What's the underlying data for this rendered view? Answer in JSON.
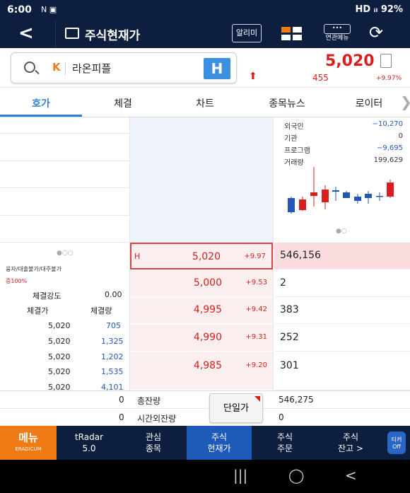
{
  "status": {
    "time": "6:00",
    "left_icons": "N ▣",
    "right": "HD ᵢₗ 92%"
  },
  "header": {
    "back_label": "<",
    "title": "주식현재가",
    "alarm_label": "알리미",
    "menu_label": "연관메뉴",
    "menu_dots": "•••",
    "refresh_label": "⟳"
  },
  "search": {
    "badge": "K",
    "stock_name": "라온피플",
    "h_button": "H"
  },
  "quote": {
    "price": "5,020",
    "change": "455",
    "pct": "+9.97%",
    "arrow": "⬆"
  },
  "tabs": [
    "호가",
    "체결",
    "차트",
    "종목뉴스",
    "로이터"
  ],
  "info": [
    {
      "label": "외국인",
      "value": "−10,270",
      "color": "#2257b5"
    },
    {
      "label": "기관",
      "value": "0",
      "color": "#333333"
    },
    {
      "label": "프로그램",
      "value": "−9,695",
      "color": "#2257b5"
    },
    {
      "label": "거래량",
      "value": "199,629",
      "color": "#333333"
    }
  ],
  "left_info": {
    "dots": "●○○",
    "flags": "융자/대출불가/대주불가",
    "margin": "증100%",
    "strength_label": "체결강도",
    "strength_value": "0.00",
    "col_price": "체결가",
    "col_qty": "체결량"
  },
  "trades": [
    {
      "price": "5,020",
      "qty": "705"
    },
    {
      "price": "5,020",
      "qty": "1,325"
    },
    {
      "price": "5,020",
      "qty": "1,202"
    },
    {
      "price": "5,020",
      "qty": "1,535"
    },
    {
      "price": "5,020",
      "qty": "4,101"
    }
  ],
  "asks": [
    {
      "mark": "H",
      "price": "5,020",
      "rate": "+9.97",
      "qty": "546,156"
    },
    {
      "mark": "",
      "price": "5,000",
      "rate": "+9.53",
      "qty": "2"
    },
    {
      "mark": "",
      "price": "4,995",
      "rate": "+9.42",
      "qty": "383"
    },
    {
      "mark": "",
      "price": "4,990",
      "rate": "+9.31",
      "qty": "252"
    },
    {
      "mark": "",
      "price": "4,985",
      "rate": "+9.20",
      "qty": "301"
    }
  ],
  "summary": {
    "left1": "0",
    "left2": "0",
    "total_label": "총잔량",
    "total_value": "546,275",
    "after_label": "시간외잔량",
    "after_value": "0",
    "dangil": "단일가"
  },
  "chart_dots": "●○",
  "bottom_nav": {
    "menu_label": "메뉴",
    "menu_sub": "ERADICUM",
    "items": [
      "tRadar\n5.0",
      "관심\n종목",
      "주식\n현재가",
      "주식\n주문",
      "주식\n잔고 >"
    ],
    "off_label": "티커 Off"
  },
  "system_nav": {
    "recent": "|||",
    "home": "◯",
    "back": "<"
  },
  "colors": {
    "navy": "#0e1e3e",
    "up": "#d81e1e",
    "down": "#2257b5",
    "accent": "#2f7fd6"
  }
}
